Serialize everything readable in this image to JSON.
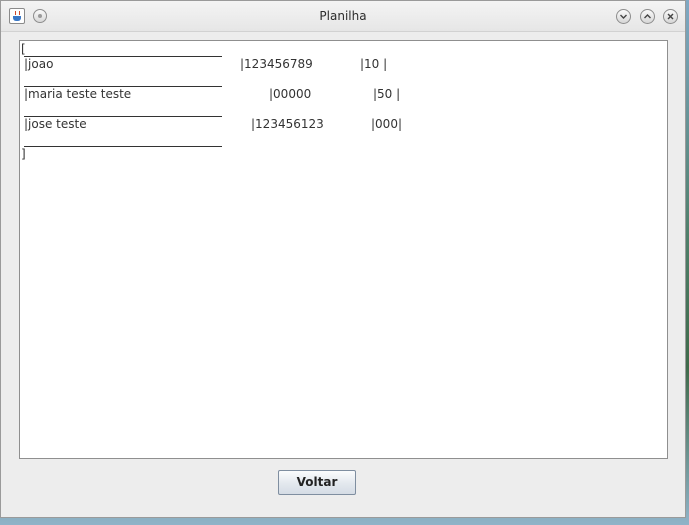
{
  "window": {
    "title": "Planilha"
  },
  "content": {
    "open_bracket": "[",
    "close_bracket": "]",
    "rows": [
      {
        "name": "|joao",
        "phone": "|123456789",
        "value": "|10 |"
      },
      {
        "name": "|maria teste teste",
        "phone": "|00000",
        "value": "|50 |"
      },
      {
        "name": "|jose teste",
        "phone": "|123456123",
        "value": "|000|"
      }
    ]
  },
  "footer": {
    "back_label": "Voltar"
  },
  "icons": {
    "app": "java-app-icon",
    "menu": "window-menu-icon",
    "minimize": "chevron-down-icon",
    "maximize": "chevron-up-icon",
    "close": "close-icon"
  }
}
